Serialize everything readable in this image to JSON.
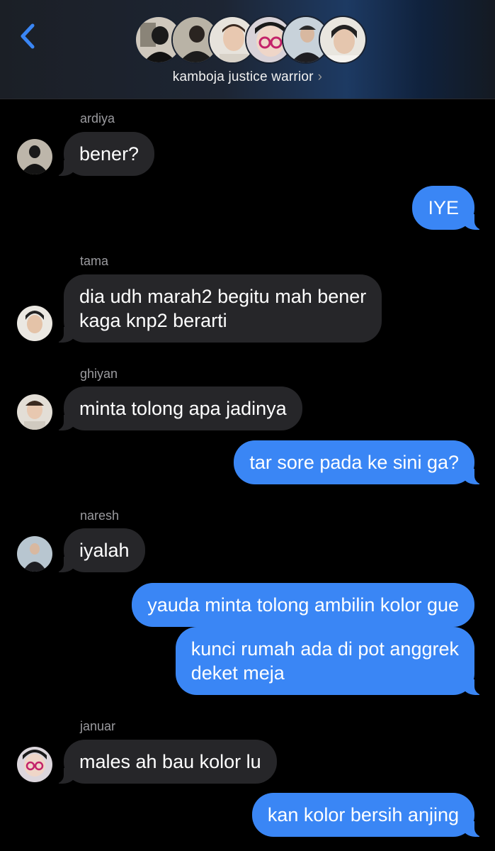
{
  "header": {
    "group_name": "kamboja justice warrior",
    "chevron": "›",
    "back_icon": "chevron-left-icon",
    "member_avatar_count": 6
  },
  "colors": {
    "accent": "#3a86f5",
    "incoming_bubble": "#262629",
    "sender_label": "#9b9b9f",
    "background": "#000000"
  },
  "messages": [
    {
      "direction": "in",
      "sender": "ardiya",
      "text": "bener?"
    },
    {
      "direction": "out",
      "text": "IYE"
    },
    {
      "direction": "in",
      "sender": "tama",
      "text_line1": "dia udh marah2 begitu mah bener",
      "text_line2": "kaga knp2 berarti"
    },
    {
      "direction": "in",
      "sender": "ghiyan",
      "text": "minta tolong apa jadinya"
    },
    {
      "direction": "out",
      "text": "tar sore pada ke sini ga?"
    },
    {
      "direction": "in",
      "sender": "naresh",
      "text": "iyalah"
    },
    {
      "direction": "out",
      "text": "yauda minta tolong ambilin kolor gue"
    },
    {
      "direction": "out",
      "text_line1": "kunci rumah ada di pot anggrek",
      "text_line2": "deket meja"
    },
    {
      "direction": "in",
      "sender": "januar",
      "text": "males ah bau kolor lu"
    },
    {
      "direction": "out",
      "text": "kan kolor bersih anjing"
    }
  ]
}
